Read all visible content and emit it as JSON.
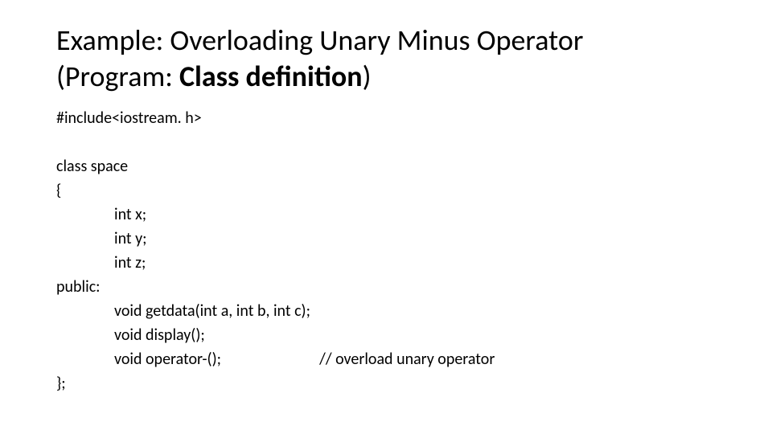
{
  "title": {
    "line1a": "Example: Overloading Unary Minus Operator",
    "line2a": "(Program: ",
    "line2b": "Class definition",
    "line2c": ")"
  },
  "code": {
    "l1": "#include<iostream. h>",
    "l2": "class space",
    "l3": "{",
    "l4": "int x;",
    "l5": "int y;",
    "l6": "int z;",
    "l7": "public:",
    "l8": "void getdata(int a, int b, int c);",
    "l9": "void display();",
    "l10a": "void operator-();",
    "l10b": "// overload unary operator",
    "l11": "};"
  }
}
